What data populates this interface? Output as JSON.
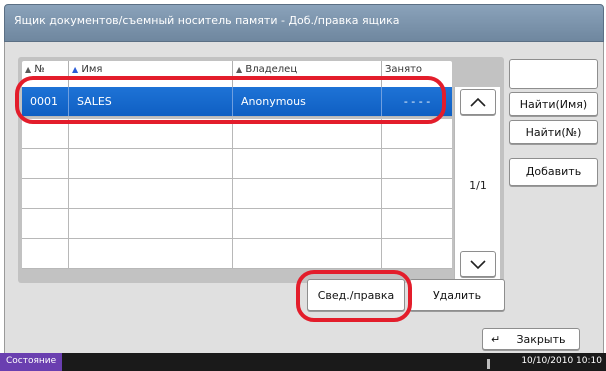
{
  "title": "Ящик документов/съемный носитель памяти - Доб./правка ящика",
  "columns": {
    "no": "№",
    "name": "Имя",
    "owner": "Владелец",
    "used": "Занято"
  },
  "rows": [
    {
      "no": "0001",
      "name": "SALES",
      "owner": "Anonymous",
      "used": "- - - -"
    },
    {
      "no": "",
      "name": "",
      "owner": "",
      "used": ""
    },
    {
      "no": "",
      "name": "",
      "owner": "",
      "used": ""
    },
    {
      "no": "",
      "name": "",
      "owner": "",
      "used": ""
    },
    {
      "no": "",
      "name": "",
      "owner": "",
      "used": ""
    },
    {
      "no": "",
      "name": "",
      "owner": "",
      "used": ""
    }
  ],
  "page_indicator": "1/1",
  "buttons": {
    "find_name": "Найти(Имя)",
    "find_no": "Найти(№)",
    "add": "Добавить",
    "details_edit": "Свед./правка",
    "delete": "Удалить",
    "close": "Закрыть"
  },
  "status": {
    "label": "Состояние",
    "datetime": "10/10/2010  10:10"
  },
  "colors": {
    "title_bar": "#7e96ae",
    "selected_row": "#1a6bd0",
    "highlight_ring": "#e31d2b",
    "status_label": "#6a3fb0"
  }
}
